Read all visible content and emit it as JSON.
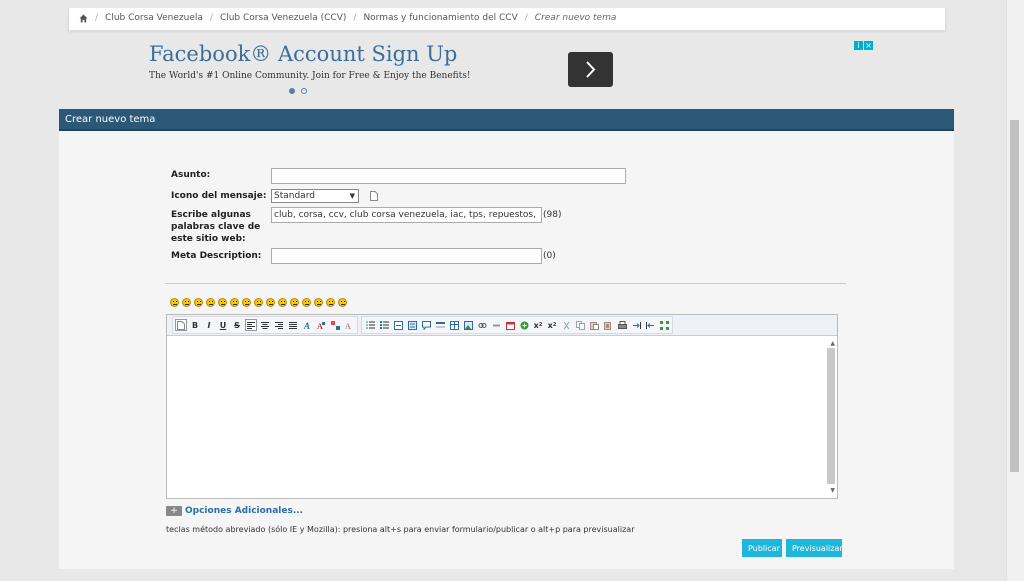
{
  "breadcrumb": {
    "items": [
      "Club Corsa Venezuela",
      "Club Corsa Venezuela (CCV)",
      "Normas y funcionamiento del CCV"
    ],
    "current": "Crear nuevo tema"
  },
  "ad": {
    "title": "Facebook® Account Sign Up",
    "subtitle": "The World's #1 Online Community. Join for Free & Enjoy the Benefits!"
  },
  "panel": {
    "title": "Crear nuevo tema"
  },
  "form": {
    "subject_label": "Asunto:",
    "subject_value": "",
    "icon_label": "Icono del mensaje:",
    "icon_selected": "Standard",
    "keywords_label": "Escribe algunas palabras clave de este sitio web:",
    "keywords_value": "club, corsa, ccv, club corsa venezuela, iac, tps, repuestos, performance",
    "keywords_count": "(98)",
    "meta_label": "Meta Description:",
    "meta_value": "",
    "meta_count": "(0)"
  },
  "toolbar": {
    "bold": "B",
    "italic": "I",
    "underline": "U",
    "strike": "S",
    "subscript": "x",
    "superscript": "x"
  },
  "more_options": {
    "icon": "+",
    "label": "Opciones Adicionales..."
  },
  "shortcut_text": "teclas método abreviado (sólo IE y Mozilla): presiona alt+s para enviar formulario/publicar o alt+p para previsualizar",
  "buttons": {
    "publish": "Publicar",
    "preview": "Previsualizar"
  },
  "colors": {
    "header": "#2c5877",
    "button": "#1fb6dc",
    "link": "#2a6fa8",
    "ad_title": "#3a6e9b"
  }
}
